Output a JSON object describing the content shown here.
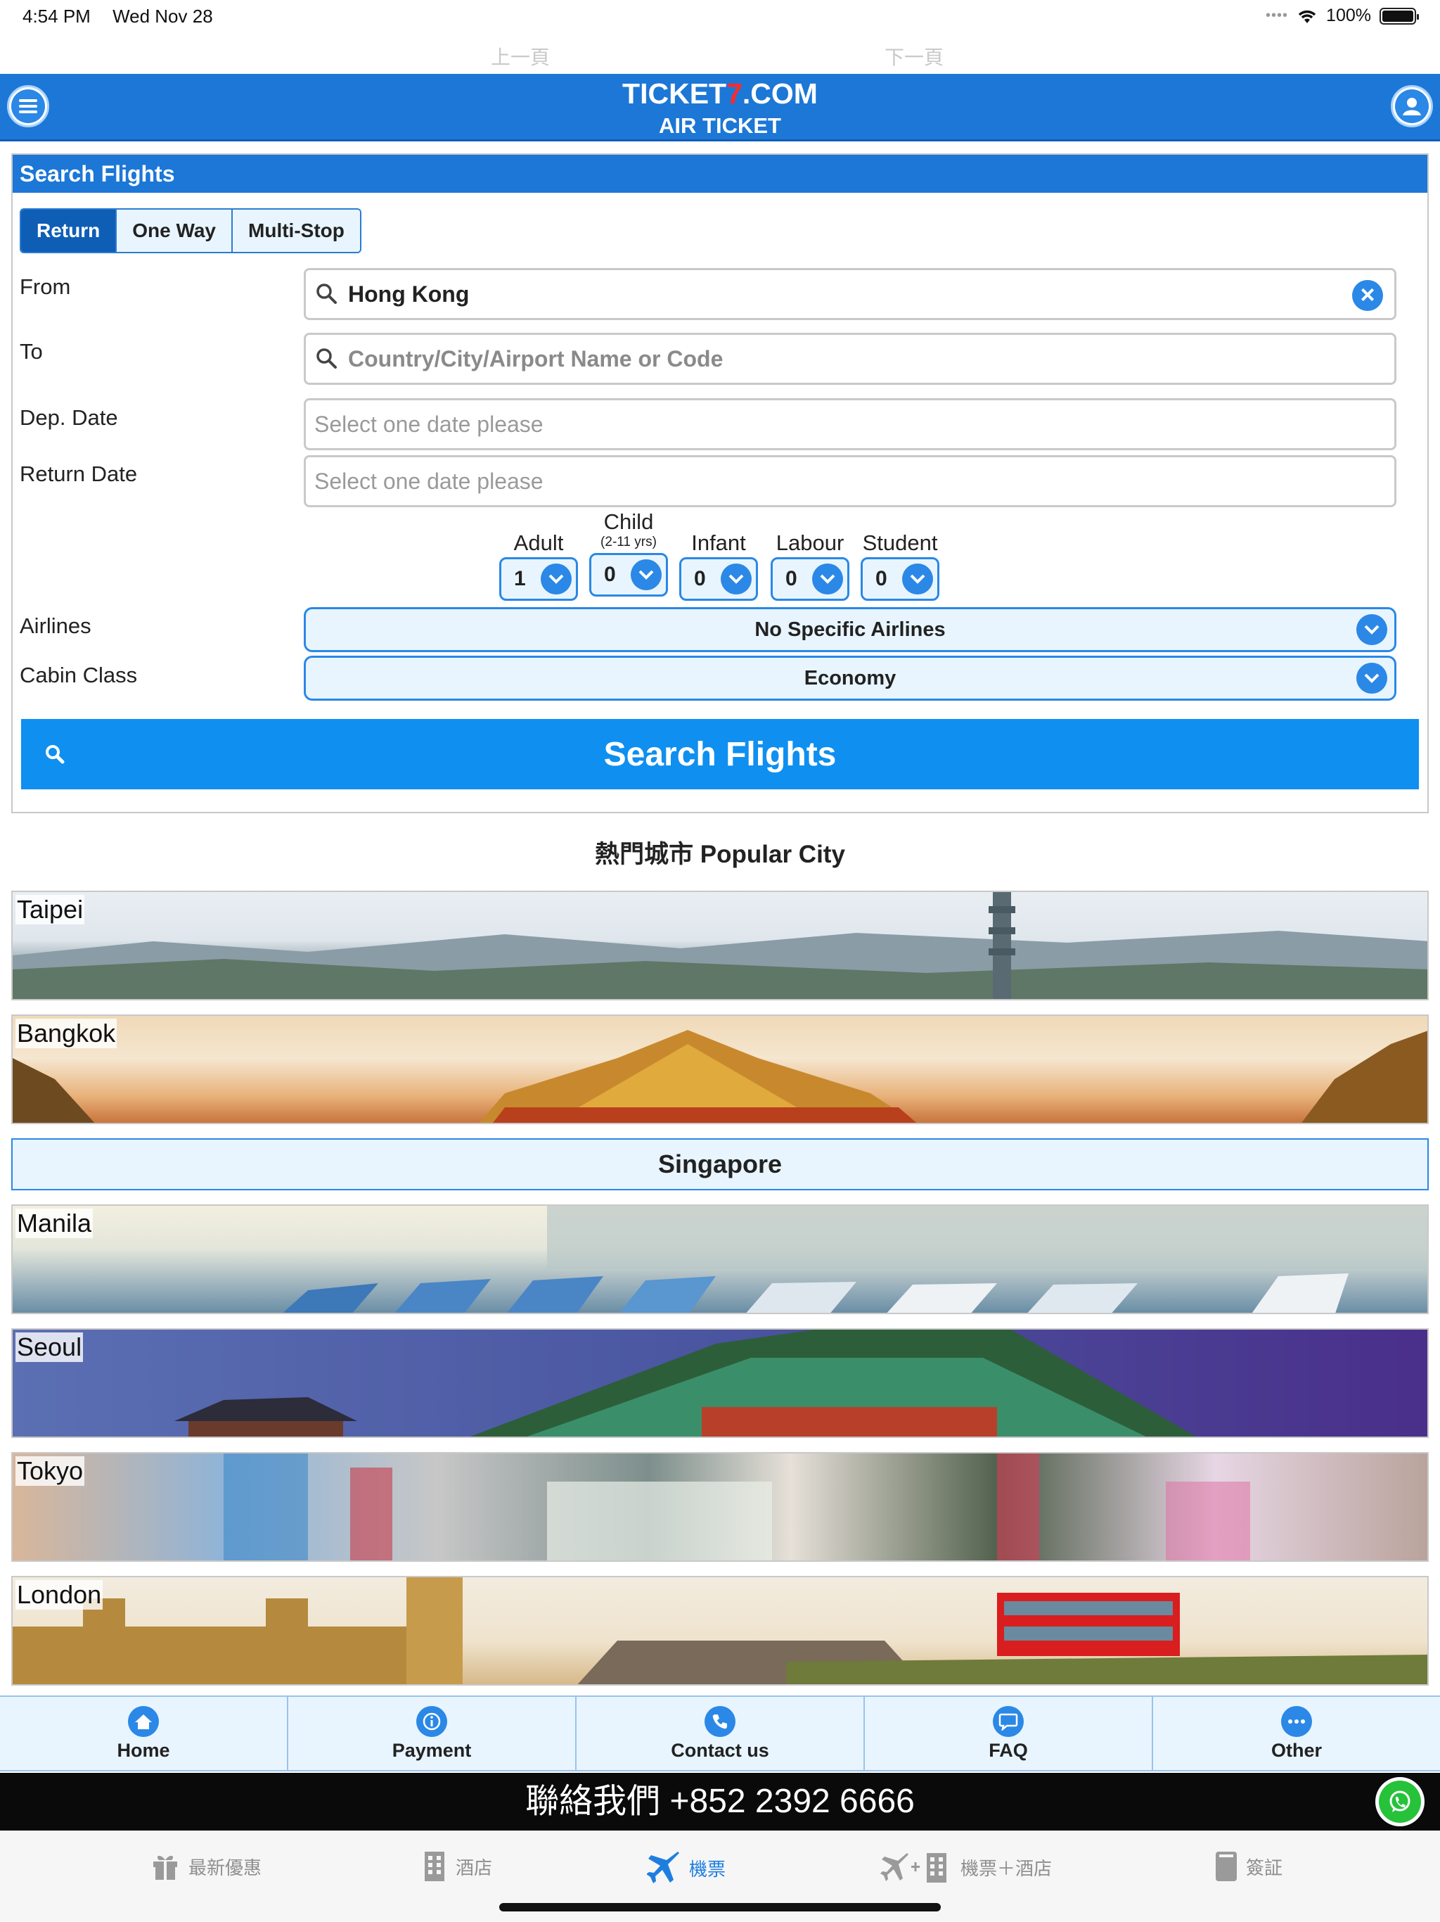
{
  "status": {
    "time": "4:54 PM",
    "date": "Wed Nov 28",
    "battery": "100%"
  },
  "nav_top": {
    "prev": "上一頁",
    "next": "下一頁"
  },
  "header": {
    "brand_a": "TICKET",
    "brand_seven": "7",
    "brand_b": ".COM",
    "subtitle": "AIR TICKET"
  },
  "search": {
    "title": "Search Flights",
    "tabs": [
      {
        "label": "Return",
        "active": true
      },
      {
        "label": "One Way",
        "active": false
      },
      {
        "label": "Multi-Stop",
        "active": false
      }
    ],
    "from_label": "From",
    "from_value": "Hong Kong",
    "to_label": "To",
    "to_placeholder": "Country/City/Airport Name or Code",
    "dep_label": "Dep. Date",
    "dep_placeholder": "Select one date please",
    "ret_label": "Return Date",
    "ret_placeholder": "Select one date please",
    "passengers": [
      {
        "label": "Adult",
        "sub": "",
        "value": "1"
      },
      {
        "label": "Child",
        "sub": "(2-11 yrs)",
        "value": "0"
      },
      {
        "label": "Infant",
        "sub": "",
        "value": "0"
      },
      {
        "label": "Labour",
        "sub": "",
        "value": "0"
      },
      {
        "label": "Student",
        "sub": "",
        "value": "0"
      }
    ],
    "airlines_label": "Airlines",
    "airlines_value": "No Specific Airlines",
    "cabin_label": "Cabin Class",
    "cabin_value": "Economy",
    "button": "Search Flights"
  },
  "popular": {
    "title": "熱門城市 Popular City",
    "cities": [
      "Taipei",
      "Bangkok",
      "Singapore",
      "Manila",
      "Seoul",
      "Tokyo",
      "London"
    ]
  },
  "bottom_nav": [
    "Home",
    "Payment",
    "Contact us",
    "FAQ",
    "Other"
  ],
  "contact": "聯絡我們 +852 2392 6666",
  "tabbar": [
    {
      "label": "最新優惠",
      "icon": "gift-icon"
    },
    {
      "label": "酒店",
      "icon": "building-icon"
    },
    {
      "label": "機票",
      "icon": "plane-icon",
      "active": true
    },
    {
      "label": "機票＋酒店",
      "icon": "plane-plus-hotel-icon"
    },
    {
      "label": "簽証",
      "icon": "passport-icon"
    }
  ],
  "colors": {
    "primary": "#1c77d6",
    "button": "#0f8ff0",
    "light": "#e8f5ff",
    "accent_red": "#ff2a2a"
  }
}
